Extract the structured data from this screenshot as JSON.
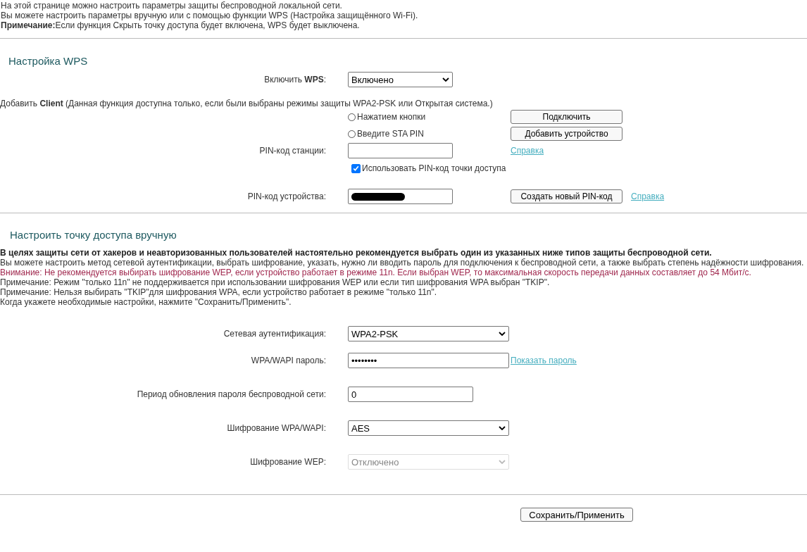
{
  "intro": [
    "На этой странице можно настроить параметры защиты беспроводной локальной сети.",
    "Вы можете настроить параметры вручную или с помощью функции WPS (Настройка защищённого Wi-Fi).",
    "**Примечание:**Если функция Скрыть точку доступа будет включена, WPS будет выключена."
  ],
  "wps": {
    "title": "Настройка WPS",
    "enable": {
      "label": "Включить **WPS**:",
      "value": "Включено"
    },
    "client_note": "Добавить **Client** (Данная функция доступна только, если были выбраны режимы защиты WPA2-PSK или Открытая система.)",
    "methods": [
      {
        "label": "Нажатием кнопки",
        "selected": false,
        "button": "Подключить"
      },
      {
        "label": "Введите STA PIN",
        "selected": false,
        "button": "Добавить устройство"
      }
    ],
    "station_pin": {
      "label": "PIN-код станции:",
      "link": "Справка"
    },
    "use_ap_pin": {
      "label": "Использовать PIN-код точки доступа",
      "checked": true
    },
    "device_pin": {
      "label": "PIN-код устройства:",
      "redacted": true,
      "button": "Создать новый PIN-код",
      "link": "Справка"
    }
  },
  "manual": {
    "title": "Настроить точку доступа вручную",
    "notes": [
      {
        "kind": "bold",
        "text": "В целях защиты сети от хакеров и неавторизованных пользователей настоятельно рекомендуется выбрать один из указанных ниже типов защиты беспроводной сети."
      },
      {
        "kind": "normal",
        "text": "Вы можете настроить метод сетевой аутентификации, выбрать шифрование, указать, нужно ли вводить пароль для подключения к беспроводной сети, а также выбрать степень надёжности шифрования."
      },
      {
        "kind": "warning",
        "text": "Внимание: Не рекомендуется выбирать шифрование WEP, если устройство работает в режиме 11n. Если выбран WEP, то максимальная скорость передачи данных составляет до 54 Мбит/с."
      },
      {
        "kind": "normal",
        "text": "Примечание: Режим \"только 11n\" не поддерживается при использовании шифрования WEP или если тип шифрования WPA выбран \"TKIP\"."
      },
      {
        "kind": "normal",
        "text": "Примечание: Нельзя выбирать \"TKIP\"для шифрования WPA, если устройство работает в режиме \"только 11n\"."
      },
      {
        "kind": "normal",
        "text": "Когда укажете необходимые настройки, нажмите \"Сохранить/Применить\"."
      }
    ],
    "fields": [
      {
        "kind": "select",
        "label": "Сетевая аутентификация:",
        "value": "WPA2-PSK",
        "disabled": false
      },
      {
        "kind": "password",
        "label": "WPA/WAPI пароль:",
        "value": "••••••••",
        "link": "Показать пароль"
      },
      {
        "kind": "text",
        "label": "Период обновления пароля беспроводной сети:",
        "value": "0"
      },
      {
        "kind": "select",
        "label": "Шифрование WPA/WAPI:",
        "value": "AES",
        "disabled": false
      },
      {
        "kind": "select",
        "label": "Шифрование WEP:",
        "value": "Отключено",
        "disabled": true
      }
    ]
  },
  "save_button": "Сохранить/Применить"
}
